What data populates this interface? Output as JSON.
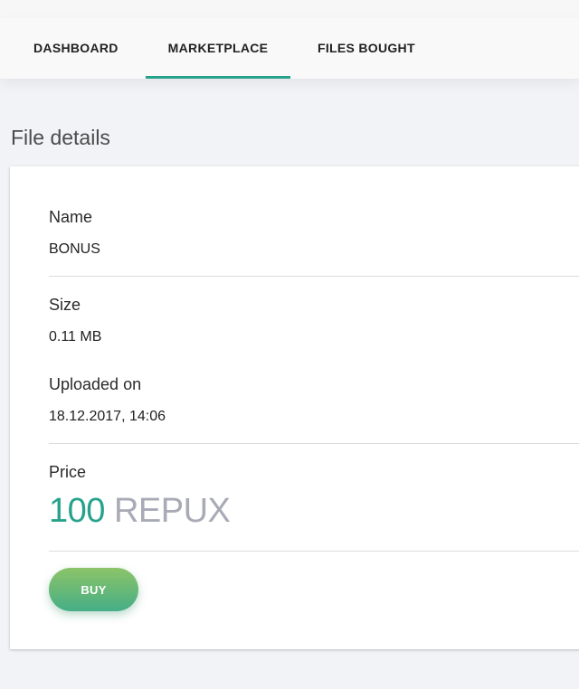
{
  "colors": {
    "accent": "#26a28a",
    "currency": "#a8aab6",
    "button_gradient_top": "#8cc468",
    "button_gradient_bottom": "#45ae86"
  },
  "nav": {
    "tabs": [
      {
        "label": "DASHBOARD",
        "active": false
      },
      {
        "label": "MARKETPLACE",
        "active": true
      },
      {
        "label": "FILES BOUGHT",
        "active": false
      }
    ]
  },
  "page": {
    "title": "File details"
  },
  "file": {
    "name_label": "Name",
    "name_value": "BONUS",
    "size_label": "Size",
    "size_value": "0.11 MB",
    "uploaded_label": "Uploaded on",
    "uploaded_value": "18.12.2017, 14:06",
    "price_label": "Price",
    "price_amount": "100",
    "price_currency": "REPUX"
  },
  "actions": {
    "buy_label": "BUY"
  }
}
